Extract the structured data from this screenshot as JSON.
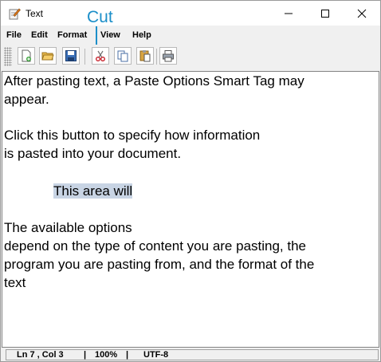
{
  "window": {
    "title": "Text"
  },
  "callout": {
    "label": "Cut"
  },
  "menu": [
    {
      "label": "File"
    },
    {
      "label": "Edit"
    },
    {
      "label": "Format"
    },
    {
      "label": "View"
    },
    {
      "label": "Help"
    }
  ],
  "toolbar": [
    {
      "icon": "new-document-icon"
    },
    {
      "icon": "open-folder-icon"
    },
    {
      "icon": "save-icon"
    },
    {
      "icon": "cut-icon"
    },
    {
      "icon": "copy-icon"
    },
    {
      "icon": "paste-icon"
    },
    {
      "icon": "print-icon"
    }
  ],
  "document": {
    "lines": [
      "After pasting text, a Paste Options Smart Tag may",
      "appear.",
      "",
      "Click this button to specify how information",
      "is pasted into your document.",
      "",
      "This area will",
      "",
      "The available options",
      "depend on the type of content you are pasting, the",
      "program you are pasting from, and the format of the",
      "text"
    ]
  },
  "status": {
    "position": "Ln 7 , Col 3",
    "zoom": "100%",
    "encoding": "UTF-8",
    "sep": "|"
  },
  "colors": {
    "callout": "#1c8fc9",
    "selection": "#c8d4e4"
  }
}
